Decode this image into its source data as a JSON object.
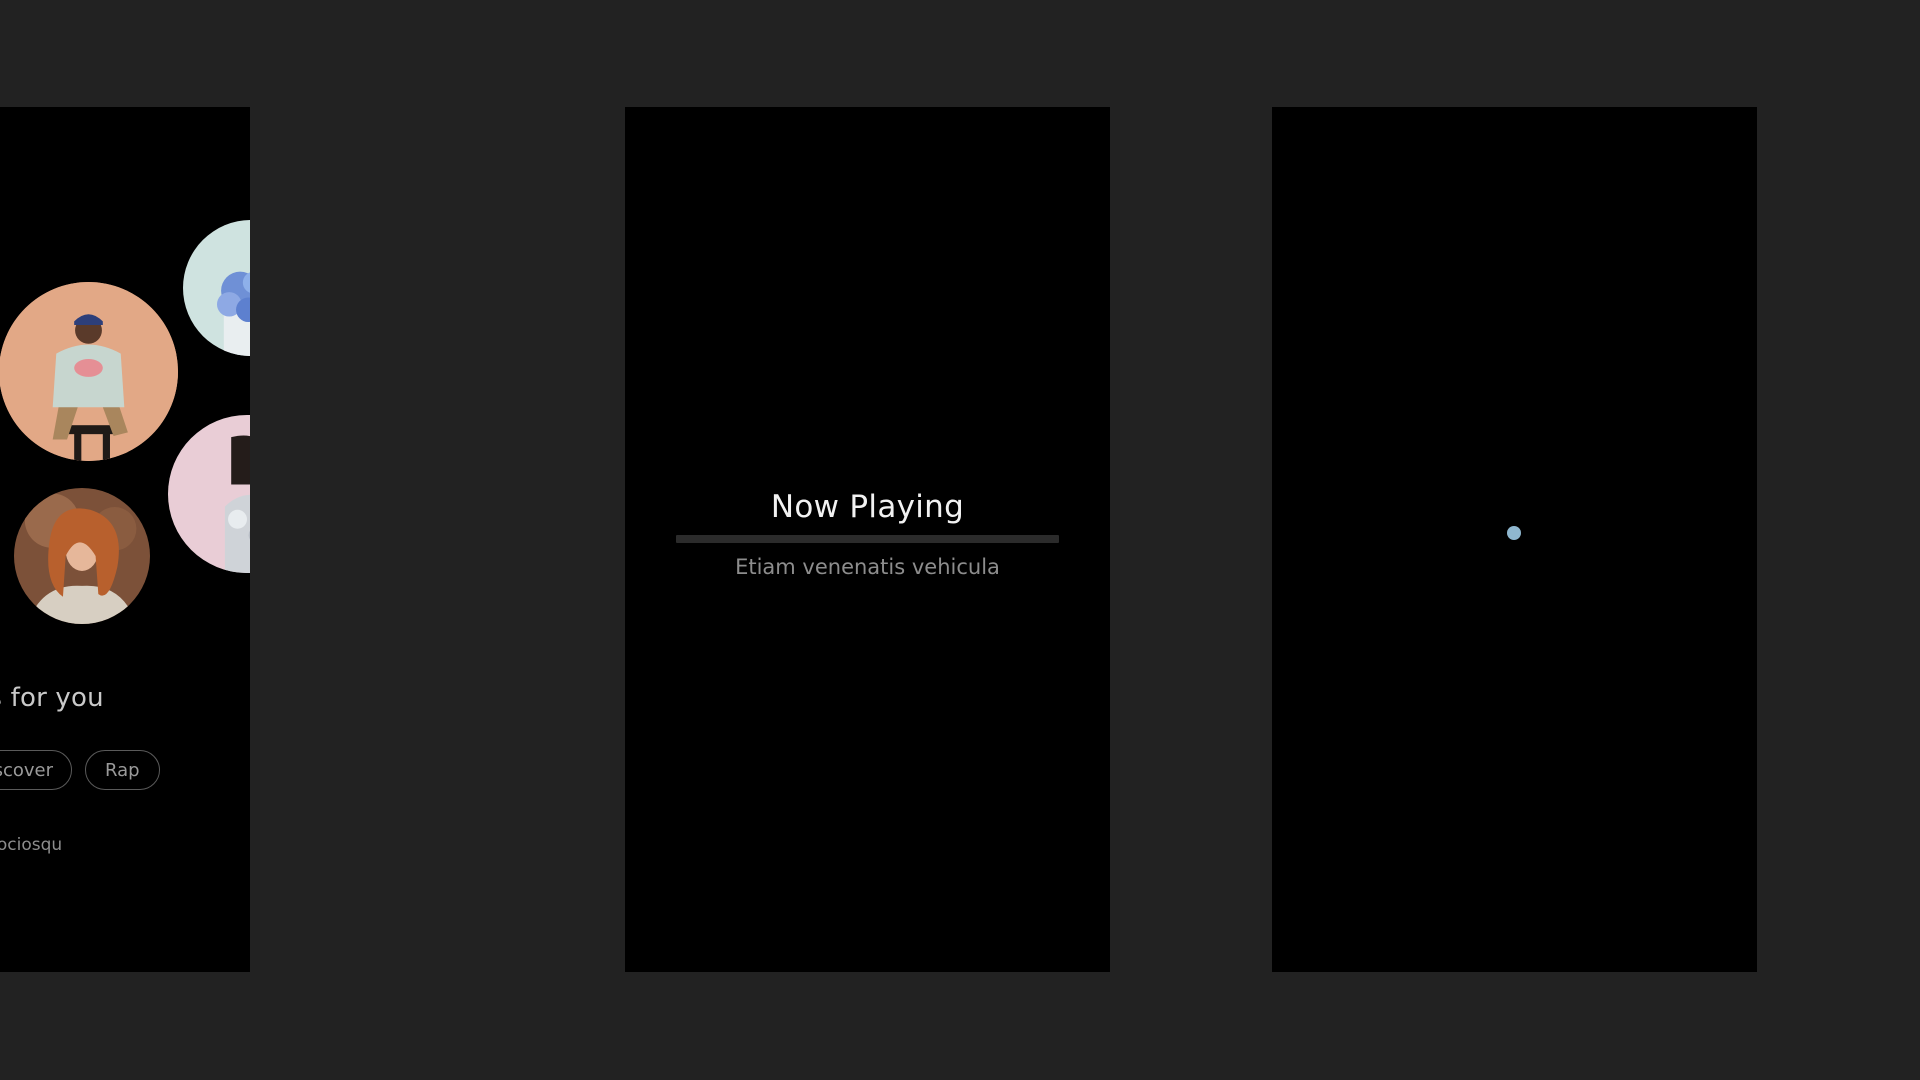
{
  "discover_panel": {
    "section_title": "ts for you",
    "chips": [
      "scover",
      "Rap"
    ],
    "subtext": "sociosqu",
    "artists": [
      "artist-portrait-1",
      "artist-portrait-2",
      "artist-portrait-3",
      "artist-portrait-4"
    ]
  },
  "now_playing_panel": {
    "title": "Now Playing",
    "track_name": "Etiam venenatis vehicula",
    "progress_fraction": 0
  },
  "loading_panel": {
    "indicator_color": "#8fb7cf"
  },
  "colors": {
    "background": "#222222",
    "panel": "#000000",
    "accent": "#8fb7cf"
  }
}
